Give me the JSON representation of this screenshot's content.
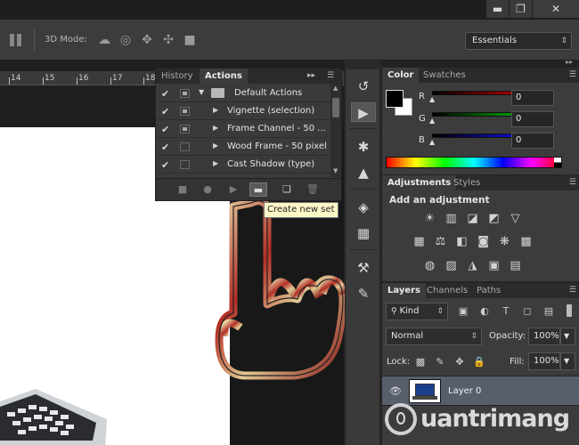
{
  "window": {
    "minimize_icon": "minimize-icon",
    "restore_icon": "restore-icon",
    "close_icon": "close-icon"
  },
  "options_bar": {
    "mode_label": "3D Mode:",
    "workspace": "Essentials"
  },
  "ruler": {
    "ticks": [
      "14",
      "15",
      "16",
      "17",
      "18"
    ]
  },
  "actions_panel": {
    "tabs": [
      "History",
      "Actions"
    ],
    "active_tab": "Actions",
    "rows": [
      {
        "label": "Default Actions",
        "checked": true,
        "toggle": true,
        "expanded": true,
        "is_set": true
      },
      {
        "label": "Vignette (selection)",
        "checked": true,
        "toggle": true,
        "expanded": false,
        "is_set": false
      },
      {
        "label": "Frame Channel - 50 ...",
        "checked": true,
        "toggle": true,
        "expanded": false,
        "is_set": false
      },
      {
        "label": "Wood Frame - 50 pixel",
        "checked": true,
        "toggle": false,
        "expanded": false,
        "is_set": false
      },
      {
        "label": "Cast Shadow (type)",
        "checked": true,
        "toggle": false,
        "expanded": false,
        "is_set": false
      }
    ],
    "tooltip": "Create new set"
  },
  "color_panel": {
    "tabs": [
      "Color",
      "Swatches"
    ],
    "active_tab": "Color",
    "channels": [
      {
        "label": "R",
        "value": "0",
        "color": "#d00000"
      },
      {
        "label": "G",
        "value": "0",
        "color": "#00b000"
      },
      {
        "label": "B",
        "value": "0",
        "color": "#1010e0"
      }
    ],
    "foreground": "#000000",
    "background": "#ffffff"
  },
  "adjustments_panel": {
    "tabs": [
      "Adjustments",
      "Styles"
    ],
    "active_tab": "Adjustments",
    "heading": "Add an adjustment"
  },
  "layers_panel": {
    "tabs": [
      "Layers",
      "Channels",
      "Paths"
    ],
    "active_tab": "Layers",
    "filter_kind": "Kind",
    "blend_mode": "Normal",
    "opacity_label": "Opacity:",
    "opacity_value": "100%",
    "lock_label": "Lock:",
    "fill_label": "Fill:",
    "fill_value": "100%",
    "layers": [
      {
        "name": "Layer 0",
        "visible": true
      }
    ]
  },
  "watermark": "uantrimang"
}
